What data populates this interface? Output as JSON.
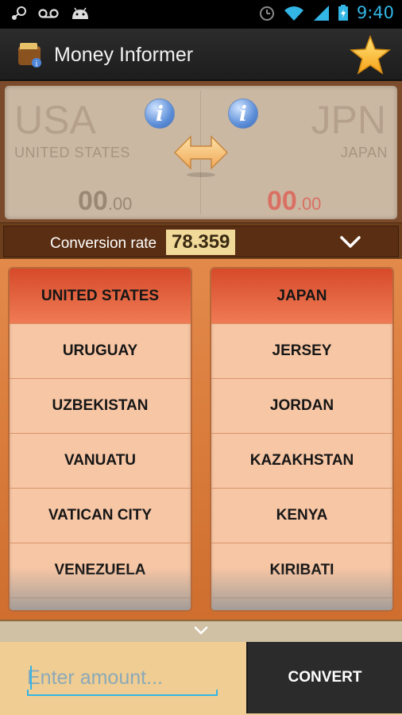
{
  "status_bar": {
    "time": "9:40",
    "icons": [
      "steam-icon",
      "voicemail-icon",
      "android-icon",
      "alarm-icon",
      "wifi-icon",
      "signal-icon",
      "battery-charging-icon"
    ],
    "accent": "#33b5e5"
  },
  "app_bar": {
    "title": "Money Informer",
    "icon": "wallet-icon",
    "action_icon": "star-icon"
  },
  "from_currency": {
    "code": "USA",
    "name": "UNITED STATES",
    "amount_whole": "00",
    "amount_fraction": ".00"
  },
  "to_currency": {
    "code": "JPN",
    "name": "JAPAN",
    "amount_whole": "00",
    "amount_fraction": ".00",
    "amount_color": "#d97063"
  },
  "conversion": {
    "label": "Conversion rate",
    "rate": "78.359"
  },
  "from_list": {
    "items": [
      "UNITED STATES",
      "URUGUAY",
      "UZBEKISTAN",
      "VANUATU",
      "VATICAN CITY",
      "VENEZUELA"
    ],
    "selected": "UNITED STATES"
  },
  "to_list": {
    "items": [
      "JAPAN",
      "JERSEY",
      "JORDAN",
      "KAZAKHSTAN",
      "KENYA",
      "KIRIBATI"
    ],
    "selected": "JAPAN"
  },
  "input": {
    "placeholder": "Enter amount...",
    "value": ""
  },
  "convert_button": {
    "label": "CONVERT"
  },
  "colors": {
    "selected_row": "#e0573a",
    "list_bg": "#f7c6a4",
    "rate_bg": "#f1d99a"
  }
}
